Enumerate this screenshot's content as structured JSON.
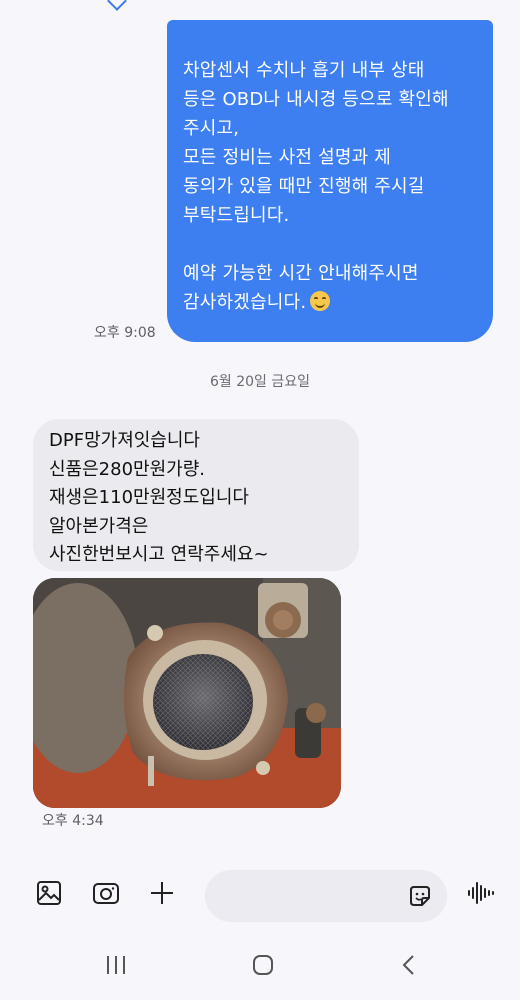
{
  "outgoing_message": {
    "lines": [
      "차압센서 수치나 흡기 내부 상태",
      "등은 OBD나 내시경 등으로 확인해",
      "주시고,",
      "모든 정비는 사전 설명과 제",
      "동의가 있을 때만 진행해 주시길",
      "부탁드립니다.",
      "",
      "예약 가능한 시간 안내해주시면",
      "감사하겠습니다."
    ],
    "emoji": "smiling-face",
    "time": "오후 9:08"
  },
  "date_divider": "6월 20일 금요일",
  "incoming_message": {
    "lines": [
      "DPF망가져잇습니다",
      "신품은280만원가량.",
      "재생은110만원정도입니다",
      "알아본가격은",
      "사진한번보시고 연락주세요~"
    ],
    "time": "오후 4:34"
  },
  "incoming_image": "photo-of-dpf-filter",
  "input_bar": {
    "gallery_icon": "image-icon",
    "camera_icon": "camera-icon",
    "add_icon": "plus-icon",
    "sticker_icon": "sticker-icon",
    "voice_icon": "voice-icon",
    "placeholder": ""
  },
  "nav_bar": [
    "recent-apps-icon",
    "home-icon",
    "back-icon"
  ],
  "colors": {
    "outgoing_bubble": "#3d7ff0",
    "incoming_bubble": "#ebeaef",
    "background": "#f7f6fb"
  }
}
